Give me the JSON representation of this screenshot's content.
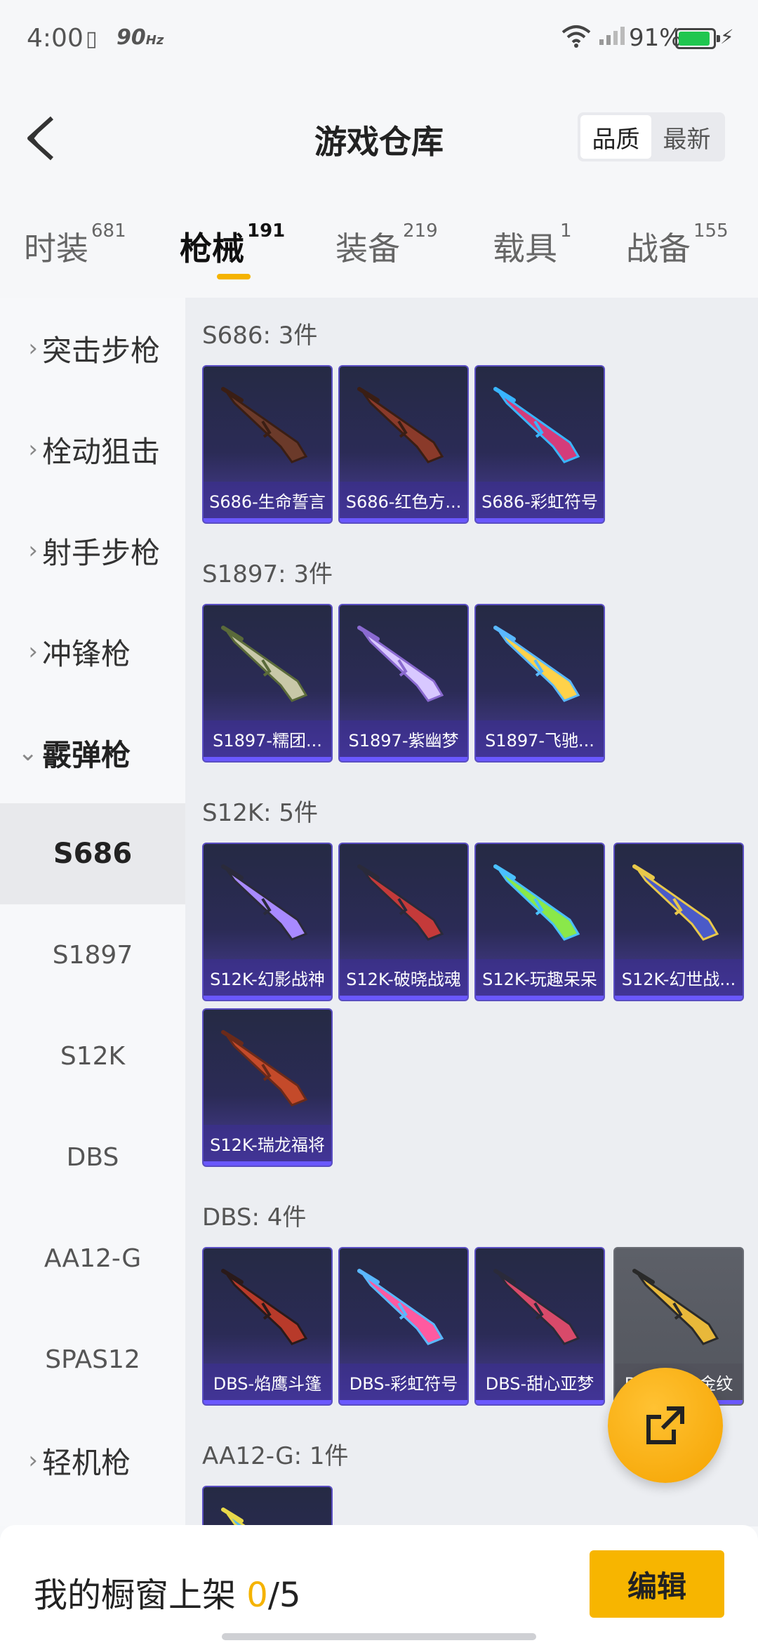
{
  "status_bar": {
    "time": "4:00",
    "refresh": "90",
    "refresh_unit": "Hz",
    "battery_pct": "91%",
    "battery_level": 0.91
  },
  "header": {
    "title": "游戏仓库",
    "sort_options": [
      "品质",
      "最新"
    ],
    "sort_selected": "品质"
  },
  "tabs": [
    {
      "label": "时装",
      "count": "681"
    },
    {
      "label": "枪械",
      "count": "191",
      "active": true
    },
    {
      "label": "装备",
      "count": "219"
    },
    {
      "label": "载具",
      "count": "1"
    },
    {
      "label": "战备",
      "count": "155"
    }
  ],
  "sidebar": {
    "categories": [
      "突击步枪",
      "栓动狙击",
      "射手步枪",
      "冲锋枪",
      "霰弹枪",
      "轻机枪"
    ],
    "open_category": "霰弹枪",
    "subcategories": [
      "S686",
      "S1897",
      "S12K",
      "DBS",
      "AA12-G",
      "SPAS12"
    ],
    "selected_sub": "S686"
  },
  "sections": [
    {
      "title": "S686: 3件",
      "items": [
        "S686-生命誓言",
        "S686-红色方...",
        "S686-彩虹符号"
      ]
    },
    {
      "title": "S1897: 3件",
      "items": [
        "S1897-糯团...",
        "S1897-紫幽梦",
        "S1897-飞驰..."
      ]
    },
    {
      "title": "S12K: 5件",
      "items": [
        "S12K-幻影战神",
        "S12K-破晓战魂",
        "S12K-玩趣呆呆",
        "S12K-幻世战...",
        "S12K-瑞龙福将"
      ]
    },
    {
      "title": "DBS: 4件",
      "items": [
        "DBS-焰鹰斗篷",
        "DBS-彩虹符号",
        "DBS-甜心亚梦",
        "DBS-乌木金纹"
      ]
    },
    {
      "title": "AA12-G: 1件",
      "items": [
        ""
      ]
    }
  ],
  "bottom": {
    "shelf_label": "我的橱窗上架 ",
    "shelf_count": "0",
    "shelf_total": "/5",
    "edit_label": "编辑"
  },
  "colors": {
    "accent": "#f5b300",
    "card": "#2b2b56",
    "card_border": "#5a4ec2"
  }
}
